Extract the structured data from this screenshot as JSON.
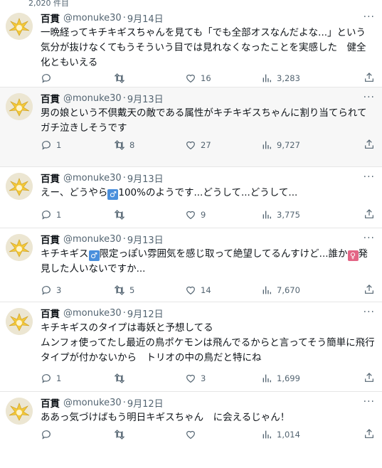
{
  "header": {
    "cut_count": "2,020 件目"
  },
  "icons": {
    "reply": "reply-icon",
    "retweet": "retweet-icon",
    "like": "like-icon",
    "views": "views-icon",
    "share": "share-icon",
    "more": "more-icon"
  },
  "colors": {
    "male_badge": "#4a8fdc",
    "female_badge": "#e36585",
    "secondary_text": "#536471"
  },
  "tweets": [
    {
      "name": "百貫",
      "handle": "@monuke30",
      "time": "9月14日",
      "text": "一晩経ってキチキギスちゃんを見ても「でも全部オスなんだよな...」という気分が抜けなくてもうそういう目では見れなくなったことを実感した　健全化ともいえる",
      "replies": "",
      "retweets": "",
      "likes": "16",
      "views": "3,283"
    },
    {
      "name": "百貫",
      "handle": "@monuke30",
      "time": "9月13日",
      "text": "男の娘という不倶戴天の敵である属性がキチキギスちゃんに割り当てられてガチ泣きしそうです",
      "replies": "1",
      "retweets": "8",
      "likes": "27",
      "views": "9,727"
    },
    {
      "name": "百貫",
      "handle": "@monuke30",
      "time": "9月13日",
      "text_a": "えー、どうやら",
      "text_b": "100%のようです...どうして...どうして...",
      "replies": "1",
      "retweets": "",
      "likes": "9",
      "views": "3,775"
    },
    {
      "name": "百貫",
      "handle": "@monuke30",
      "time": "9月13日",
      "text_a": "キチキギス",
      "text_b": "限定っぽい雰囲気を感じ取って絶望してるんすけど...誰か",
      "text_c": "発見した人いないですか...",
      "replies": "3",
      "retweets": "5",
      "likes": "14",
      "views": "7,670"
    },
    {
      "name": "百貫",
      "handle": "@monuke30",
      "time": "9月12日",
      "text": "キチキギスのタイプは毒妖と予想してる\nムンフォ使ってたし最近の鳥ポケモンは飛んでるからと言ってそう簡単に飛行タイプが付かないから　トリオの中の鳥だと特にね",
      "replies": "1",
      "retweets": "",
      "likes": "3",
      "views": "1,699"
    },
    {
      "name": "百貫",
      "handle": "@monuke30",
      "time": "9月12日",
      "text": "ああっ気づけばもう明日キギスちゃん　に会えるじゃん！",
      "replies": "",
      "retweets": "",
      "likes": "",
      "views": "1,014"
    }
  ]
}
